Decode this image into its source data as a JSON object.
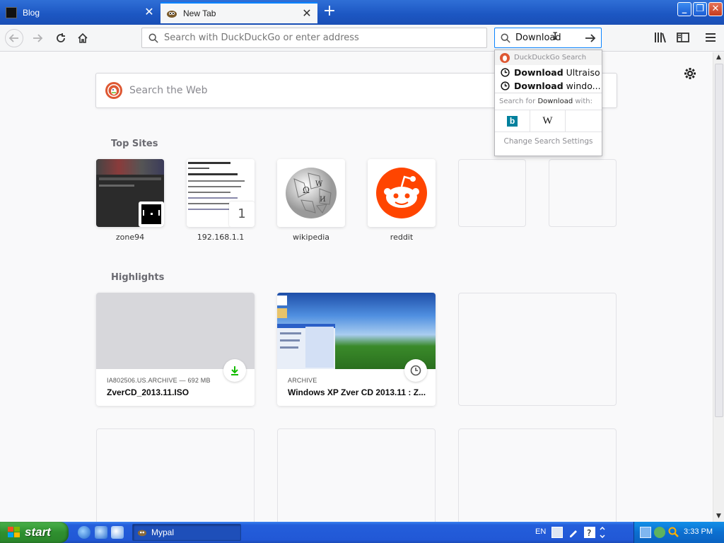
{
  "browser": {
    "tabs": [
      {
        "title": "Blog"
      },
      {
        "title": "New Tab"
      }
    ],
    "urlbar": {
      "placeholder": "Search with DuckDuckGo or enter address"
    },
    "searchbar": {
      "value": "Download"
    }
  },
  "newtab": {
    "websearch_placeholder": "Search the Web",
    "top_sites_title": "Top Sites",
    "top_sites": [
      {
        "label": "zone94"
      },
      {
        "label": "192.168.1.1",
        "badge": "1"
      },
      {
        "label": "wikipedia"
      },
      {
        "label": "reddit"
      },
      {
        "label": ""
      },
      {
        "label": ""
      }
    ],
    "highlights_title": "Highlights",
    "highlights": [
      {
        "context": "IA802506.US.ARCHIVE — 692 MB",
        "title": "ZverCD_2013.11.ISO",
        "badge_icon": "download-icon"
      },
      {
        "context": "ARCHIVE",
        "title": "Windows XP Zver CD 2013.11 : Z...",
        "badge_icon": "history-icon"
      }
    ]
  },
  "search_dropdown": {
    "header": "DuckDuckGo Search",
    "suggestions": [
      {
        "bold": "Download",
        "rest": " Ultraiso"
      },
      {
        "bold": "Download",
        "rest": " windo..."
      }
    ],
    "search_for_prefix": "Search for ",
    "search_for_keyword": "Download",
    "search_for_suffix": " with:",
    "engines": [
      "bing-icon",
      "wikipedia-icon"
    ],
    "settings_label": "Change Search Settings"
  },
  "taskbar": {
    "start_label": "start",
    "task_label": "Mypal",
    "language": "EN",
    "time": "3:33 PM"
  },
  "colors": {
    "accent": "#0a84ff",
    "reddit": "#ff4500",
    "download_green": "#12bc00",
    "taskbar_blue": "#245edb",
    "start_green": "#3a9c3a"
  }
}
